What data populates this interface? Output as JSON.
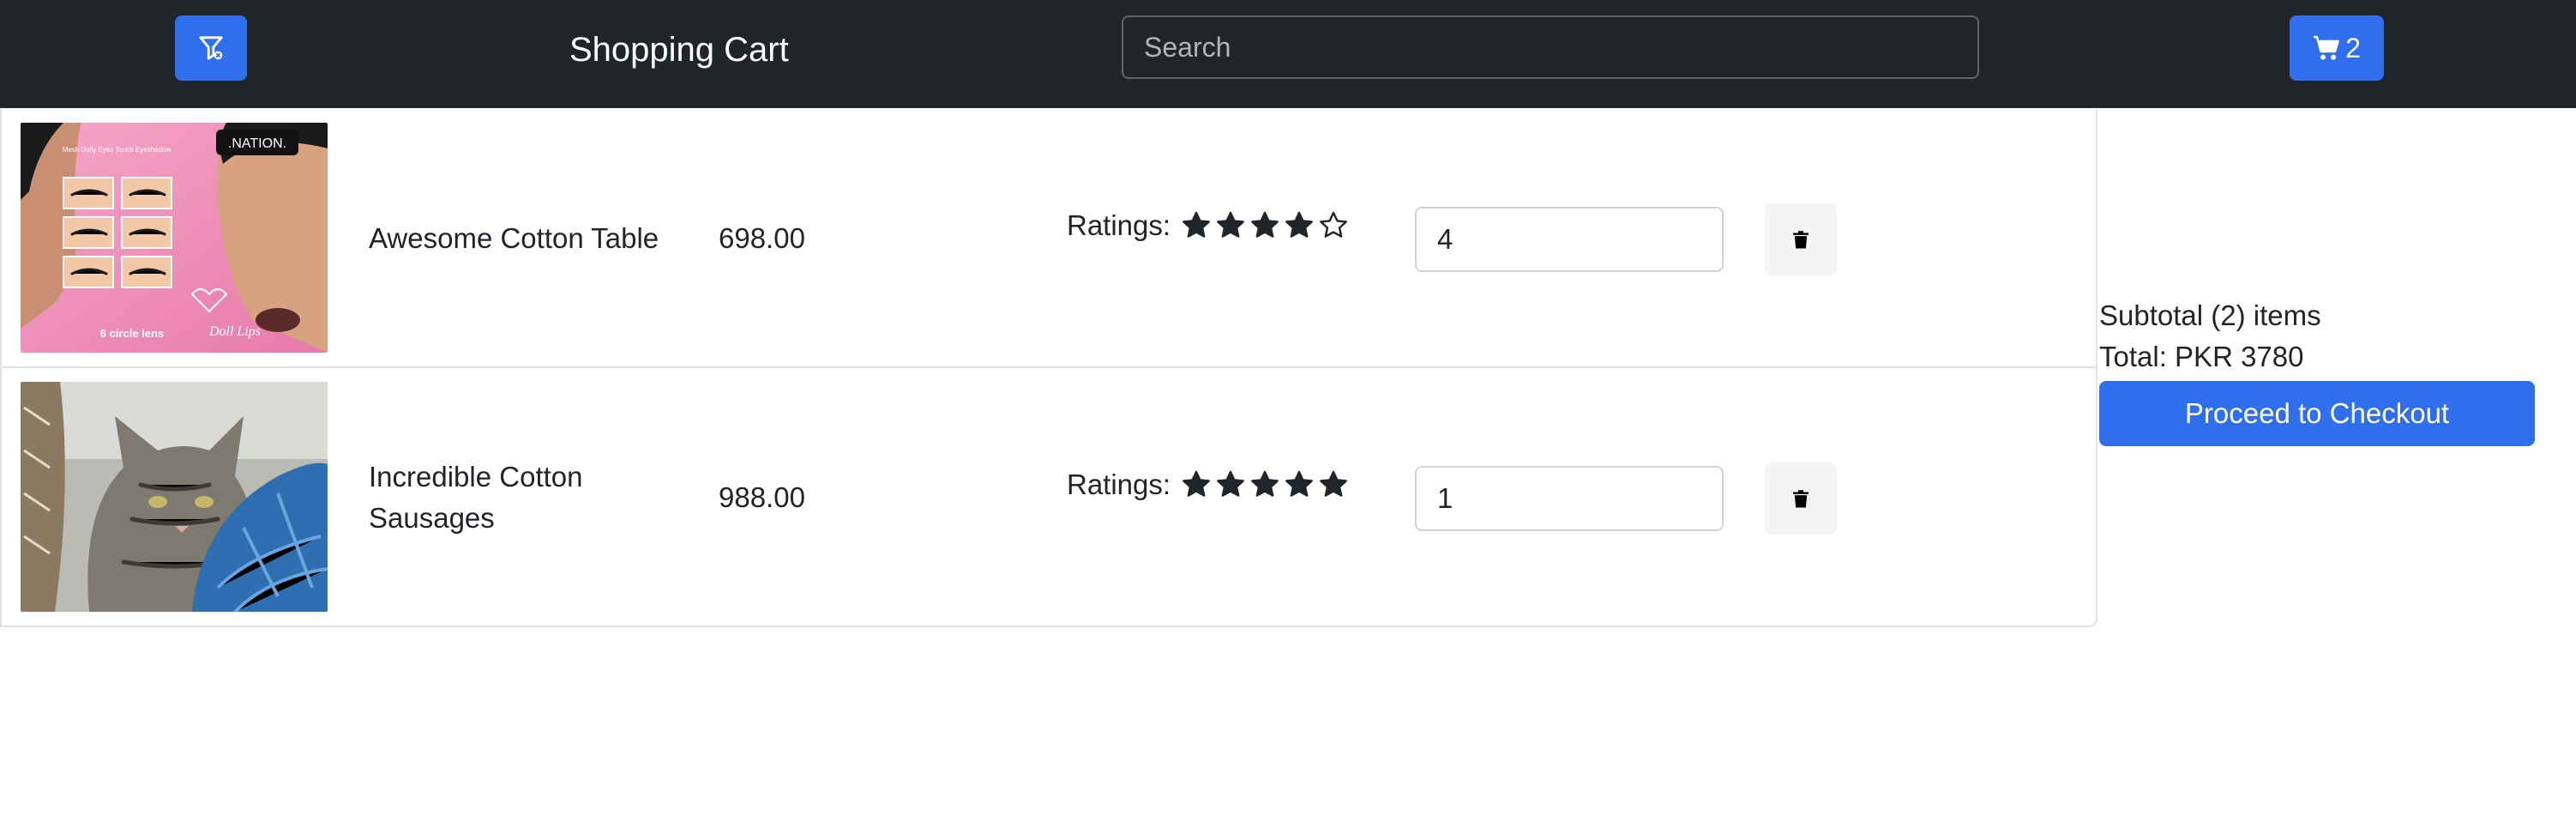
{
  "navbar": {
    "filter_icon": "filter-icon",
    "brand": "Shopping Cart",
    "search_placeholder": "Search",
    "cart_icon": "cart-icon",
    "cart_count": "2"
  },
  "cart": {
    "items": [
      {
        "image": "product-image-eyelash-ad",
        "name": "Awesome Cotton Table",
        "price": "698.00",
        "ratings_label": "Ratings:",
        "rating": 4,
        "rating_max": 5,
        "quantity": "4",
        "delete_icon": "trash-icon",
        "image_text": {
          "brand": ".NATION.",
          "caption_top": "Mesh Dolly Eyes Touch Eyeshadow",
          "circle_lens": "6 circle lens",
          "doll_lips": "Doll Lips"
        }
      },
      {
        "image": "product-image-tabby-cat",
        "name": "Incredible Cotton Sausages",
        "price": "988.00",
        "ratings_label": "Ratings:",
        "rating": 5,
        "rating_max": 5,
        "quantity": "1",
        "delete_icon": "trash-icon"
      }
    ]
  },
  "summary": {
    "subtotal": "Subtotal (2) items",
    "total": "Total: PKR 3780",
    "checkout_label": "Proceed to Checkout"
  },
  "colors": {
    "navbar_bg": "#212529",
    "primary": "#2f6fed",
    "star": "#212529",
    "border": "#dee2e6"
  }
}
